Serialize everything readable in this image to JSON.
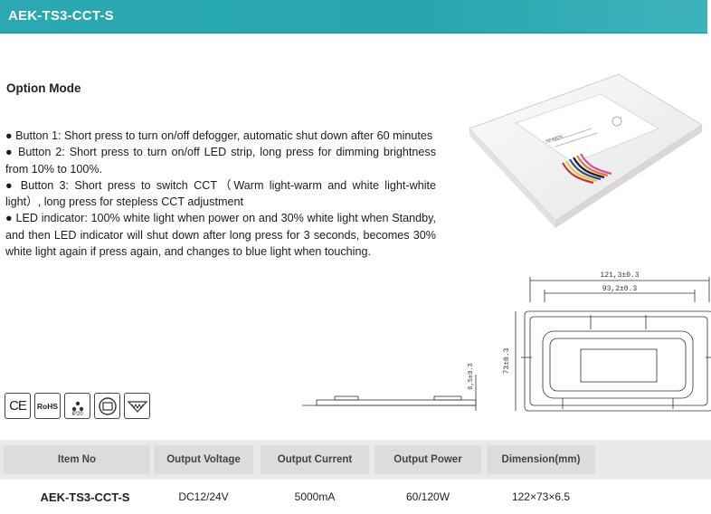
{
  "header": {
    "title": "AEK-TS3-CCT-S"
  },
  "section": {
    "title": "Option Mode"
  },
  "bullets": [
    "● Button 1: Short press to turn on/off defogger, automatic shut down after 60 minutes",
    "● Button 2: Short press to turn on/off LED strip, long press for dimming brightness from 10% to 100%.",
    "● Button 3: Short press to switch CCT（Warm light-warm and white light-white light）, long press for stepless CCT adjustment",
    "● LED indicator: 100% white light when power on and 30% white light when Standby, and then LED indicator will shut down after long press for 3 seconds, becomes 30% white light again if press again, and changes to blue light when touching."
  ],
  "product_label": "SEIMEN",
  "dimensions": {
    "outer_width": "121,3±0.3",
    "inner_width": "93,2±0.3",
    "height": "73±0.3",
    "thickness": "6,5±0.3"
  },
  "certifications": {
    "ce": "CE",
    "rohs": "RoHS",
    "ip": "IP20"
  },
  "table": {
    "headers": [
      "Item No",
      "Output Voltage",
      "Output Current",
      "Output Power",
      "Dimension(mm)"
    ],
    "row": [
      "AEK-TS3-CCT-S",
      "DC12/24V",
      "5000mA",
      "60/120W",
      "122×73×6.5"
    ]
  },
  "colors": {
    "header": "#2aa9b3",
    "table_header": "#e9e9e9"
  }
}
